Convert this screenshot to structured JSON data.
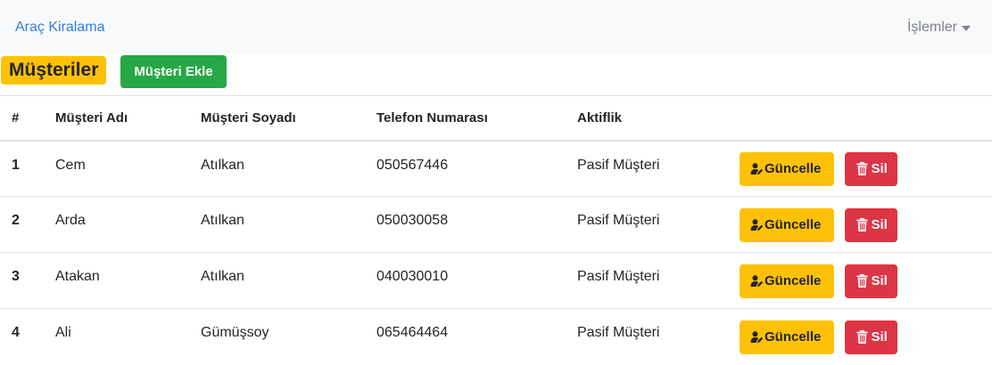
{
  "navbar": {
    "brand": "Araç Kiralama",
    "dropdown_label": "İşlemler"
  },
  "header": {
    "title": "Müşteriler",
    "add_button": "Müşteri Ekle"
  },
  "table": {
    "columns": [
      "#",
      "Müşteri Adı",
      "Müşteri Soyadı",
      "Telefon Numarası",
      "Aktiflik"
    ],
    "rows": [
      {
        "id": "1",
        "first_name": "Cem",
        "last_name": "Atılkan",
        "phone": "050567446",
        "status": "Pasif Müşteri"
      },
      {
        "id": "2",
        "first_name": "Arda",
        "last_name": "Atılkan",
        "phone": "050030058",
        "status": "Pasif Müşteri"
      },
      {
        "id": "3",
        "first_name": "Atakan",
        "last_name": "Atılkan",
        "phone": "040030010",
        "status": "Pasif Müşteri"
      },
      {
        "id": "4",
        "first_name": "Ali",
        "last_name": "Gümüşsoy",
        "phone": "065464464",
        "status": "Pasif Müşteri"
      }
    ],
    "update_label": "Güncelle",
    "delete_label": "Sil"
  },
  "icons": {
    "update": "user-edit-icon",
    "delete": "trash-icon",
    "dropdown": "caret-down-icon"
  },
  "colors": {
    "brand_link": "#2f7fd4",
    "title_badge": "#ffc107",
    "add_button": "#28a745",
    "update_button": "#ffc107",
    "delete_button": "#dc3545"
  }
}
